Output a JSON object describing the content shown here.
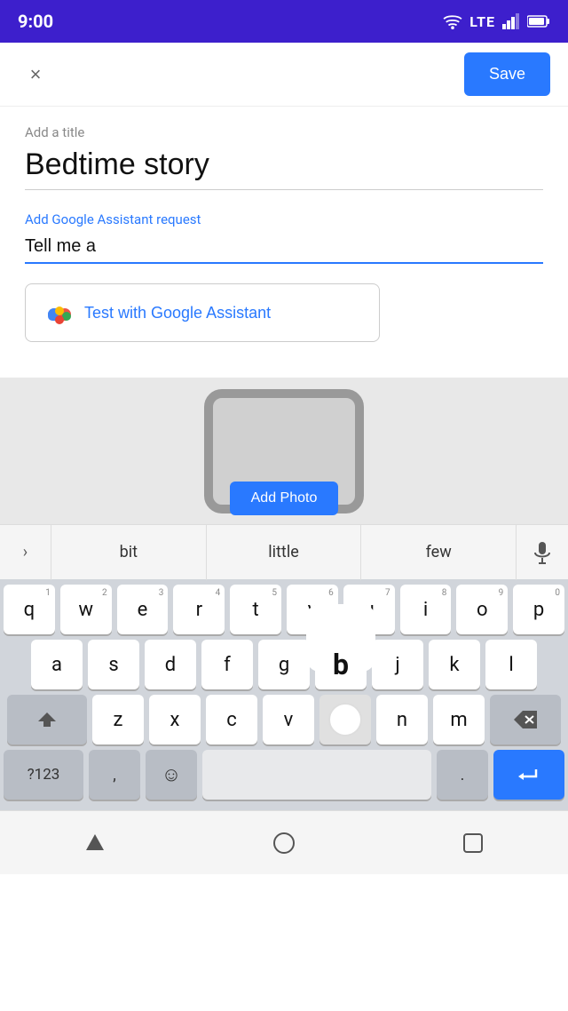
{
  "statusBar": {
    "time": "9:00",
    "icons": [
      "wifi",
      "lte",
      "signal",
      "battery"
    ]
  },
  "appBar": {
    "closeLabel": "×",
    "saveLabel": "Save"
  },
  "form": {
    "titleLabel": "Add a title",
    "titleValue": "Bedtime story",
    "gaRequestLabel": "Add Google Assistant request",
    "gaRequestValue": "Tell me a ",
    "testButtonLabel": "Test with Google Assistant"
  },
  "photoArea": {
    "addPhotoLabel": "Add Photo"
  },
  "suggestions": {
    "expandIcon": ">",
    "items": [
      "bit",
      "little",
      "few"
    ],
    "micIcon": "mic"
  },
  "keyboard": {
    "row1": [
      {
        "label": "q",
        "number": "1"
      },
      {
        "label": "w",
        "number": "2"
      },
      {
        "label": "e",
        "number": "3"
      },
      {
        "label": "r",
        "number": "4"
      },
      {
        "label": "t",
        "number": "5"
      },
      {
        "label": "y",
        "number": "6"
      },
      {
        "label": "u",
        "number": "7"
      },
      {
        "label": "i",
        "number": "8"
      },
      {
        "label": "o",
        "number": "9"
      },
      {
        "label": "p",
        "number": "0"
      }
    ],
    "row2": [
      {
        "label": "a"
      },
      {
        "label": "s"
      },
      {
        "label": "d"
      },
      {
        "label": "f"
      },
      {
        "label": "g"
      },
      {
        "label": "b",
        "highlighted": true
      },
      {
        "label": "j"
      },
      {
        "label": "k"
      },
      {
        "label": "l"
      }
    ],
    "row3": {
      "shift": "⇧",
      "keys": [
        "z",
        "x",
        "c",
        "v"
      ],
      "highlightedExtra": "b",
      "keys2": [
        "n",
        "m"
      ],
      "delete": "⌫"
    },
    "row4": {
      "symbols": "?123",
      "comma": ",",
      "emoji": "☺",
      "space": "",
      "period": ".",
      "enter": "↵"
    }
  },
  "navBar": {
    "backIcon": "▼",
    "homeIcon": "○",
    "recentIcon": "□"
  }
}
